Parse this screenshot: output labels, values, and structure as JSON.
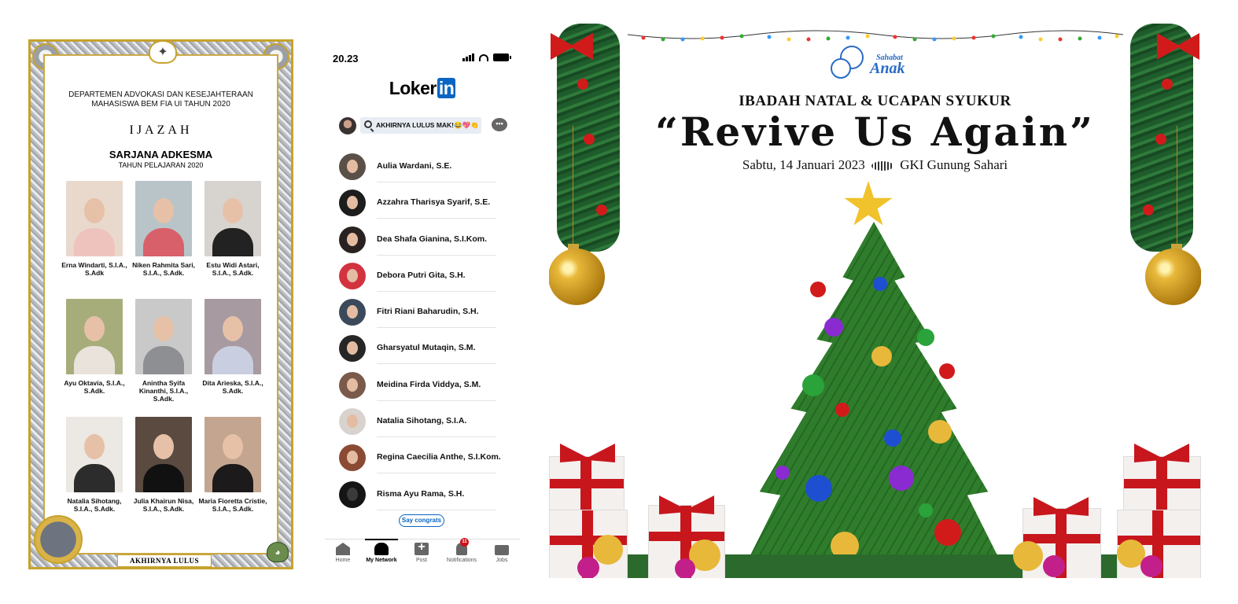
{
  "certificate": {
    "department_line1": "DEPARTEMEN ADVOKASI DAN KESEJAHTERAAN",
    "department_line2": "MAHASISWA BEM FIA UI TAHUN 2020",
    "heading": "IJAZAH",
    "degree": "SARJANA ADKESMA",
    "year": "TAHUN PELAJARAN 2020",
    "graduates": [
      {
        "name": "Erna Windarti, S.I.A., S.Adk"
      },
      {
        "name": "Niken Rahmita Sari, S.I.A., S.Adk."
      },
      {
        "name": "Estu Widi Astari, S.I.A., S.Adk."
      },
      {
        "name": "Ayu Oktavia, S.I.A., S.Adk."
      },
      {
        "name": "Anintha Syifa Kinanthi, S.I.A., S.Adk."
      },
      {
        "name": "Dita Arieska, S.I.A., S.Adk."
      },
      {
        "name": "Natalia Sihotang, S.I.A., S.Adk."
      },
      {
        "name": "Julia Khairun Nisa, S.I.A., S.Adk."
      },
      {
        "name": "Maria Fioretta Cristie, S.I.A., S.Adk."
      }
    ],
    "banner": "AKHIRNYA LULUS",
    "border_color": "#c7a22c"
  },
  "phone": {
    "status_time": "20.23",
    "logo_text": "Loker",
    "logo_badge": "in",
    "search_text": "AKHIRNYA LULUS MAK!😂💖👏",
    "connections": [
      {
        "name": "Aulia Wardani, S.E."
      },
      {
        "name": "Azzahra Tharisya Syarif, S.E."
      },
      {
        "name": "Dea Shafa Gianina, S.I.Kom."
      },
      {
        "name": "Debora Putri Gita, S.H."
      },
      {
        "name": "Fitri Riani Baharudin, S.H."
      },
      {
        "name": "Gharsyatul Mutaqin, S.M."
      },
      {
        "name": "Meidina Firda Viddya, S.M."
      },
      {
        "name": "Natalia Sihotang, S.I.A."
      },
      {
        "name": "Regina Caecilia Anthe, S.I.Kom."
      },
      {
        "name": "Risma Ayu Rama, S.H."
      }
    ],
    "say_congrats": "Say congrats",
    "tabs": [
      {
        "label": "Home",
        "icon": "home-icon"
      },
      {
        "label": "My Network",
        "icon": "network-icon"
      },
      {
        "label": "Post",
        "icon": "post-icon"
      },
      {
        "label": "Notifications",
        "icon": "bell-icon"
      },
      {
        "label": "Jobs",
        "icon": "briefcase-icon"
      }
    ],
    "active_tab": "My Network",
    "notification_count": "11",
    "accent_color": "#0a66c2"
  },
  "christmas": {
    "logo_line1": "Sahabat",
    "logo_line2": "Anak",
    "heading": "IBADAH NATAL & UCAPAN SYUKUR",
    "title": "“Revive Us Again”",
    "date": "Sabtu, 14 Januari 2023",
    "venue": "GKI Gunung Sahari",
    "colors": {
      "red": "#c8161d",
      "green": "#2f7d2c",
      "gold": "#e8b83a",
      "logo_blue": "#2a6cc4"
    }
  }
}
